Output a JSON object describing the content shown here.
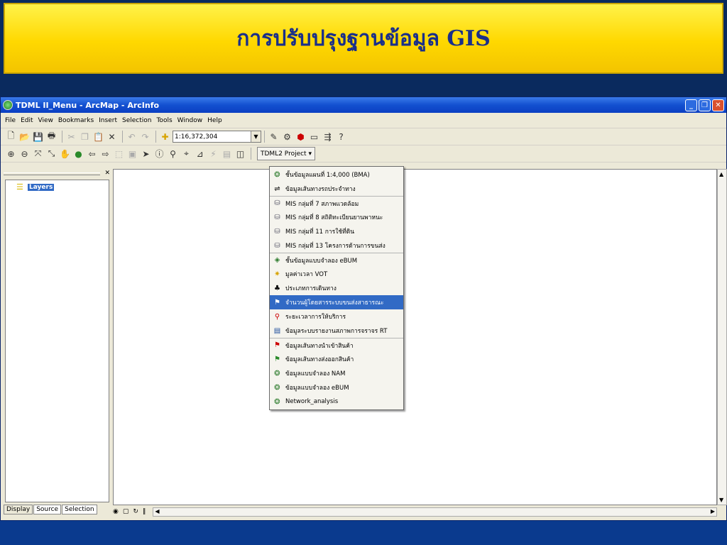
{
  "slide": {
    "title": "การปรับปรุงฐานข้อมูล GIS"
  },
  "window": {
    "title": "TDML II_Menu - ArcMap - ArcInfo",
    "controls": [
      "_",
      "❐",
      "✕"
    ]
  },
  "menubar": [
    "File",
    "Edit",
    "View",
    "Bookmarks",
    "Insert",
    "Selection",
    "Tools",
    "Window",
    "Help"
  ],
  "toolbar1": {
    "scale_value": "1:16,372,304"
  },
  "toolbar2": {
    "project_label": "TDML2 Project ▾"
  },
  "toc": {
    "root_label": "Layers",
    "tabs": [
      "Display",
      "Source",
      "Selection"
    ]
  },
  "dropdown": {
    "items": [
      {
        "label": "ชั้นข้อมูลแผนที่ 1:4,000 (BMA)",
        "icon": "globe-layers-icon"
      },
      {
        "label": "ข้อมูลเส้นทางรถประจำทาง",
        "icon": "bus-route-icon"
      },
      {
        "label": "MIS กลุ่มที่ 7 สภาพแวดล้อม",
        "icon": "database-icon"
      },
      {
        "label": "MIS กลุ่มที่ 8 สถิติทะเบียนยานพาหนะ",
        "icon": "database-icon"
      },
      {
        "label": "MIS กลุ่มที่ 11 การใช้ที่ดิน",
        "icon": "database-icon"
      },
      {
        "label": "MIS กลุ่มที่ 13 โครงการด้านการขนส่ง",
        "icon": "database-icon"
      },
      {
        "label": "ชั้นข้อมูลแบบจำลอง eBUM",
        "icon": "model-icon"
      },
      {
        "label": "มูลค่าเวลา VOT",
        "icon": "time-value-icon"
      },
      {
        "label": "ประเภทการเดินทาง",
        "icon": "trip-type-icon"
      },
      {
        "label": "จำนวนผู้โดยสารระบบขนส่งสาธารณะ",
        "icon": "passenger-icon"
      },
      {
        "label": "ระยะเวลาการให้บริการ",
        "icon": "service-time-icon"
      },
      {
        "label": "ข้อมูลระบบรายงานสภาพการจราจร RT",
        "icon": "traffic-report-icon"
      },
      {
        "label": "ข้อมูลเส้นทางนำเข้าสินค้า",
        "icon": "import-route-icon"
      },
      {
        "label": "ข้อมูลเส้นทางส่งออกสินค้า",
        "icon": "export-route-icon"
      },
      {
        "label": "ข้อมูลแบบจำลอง NAM",
        "icon": "nam-model-icon"
      },
      {
        "label": "ข้อมูลแบบจำลอง eBUM",
        "icon": "ebum-model-icon"
      },
      {
        "label": "Network_analysis",
        "icon": "network-analysis-icon"
      }
    ]
  },
  "colors": {
    "slide_bg": "#0a2a5e",
    "title_bar": "#ffd800",
    "title_text": "#1a2f8a",
    "menu_highlight": "#316ac5"
  }
}
